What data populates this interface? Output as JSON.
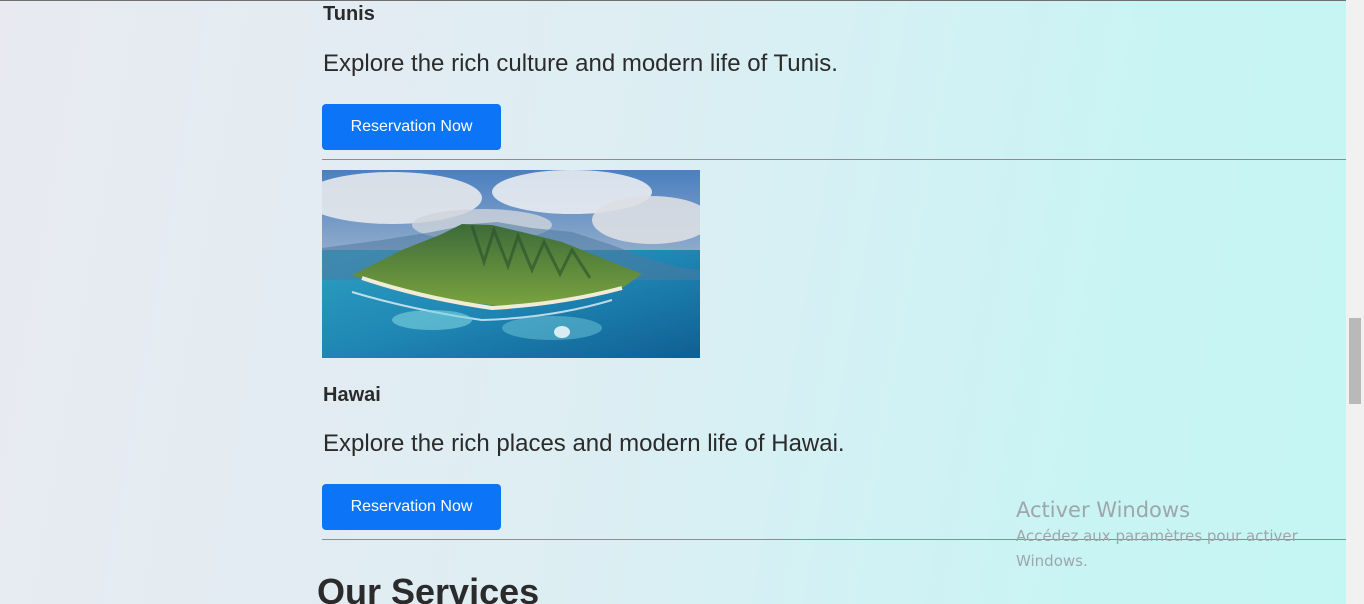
{
  "destinations": [
    {
      "title": "Tunis",
      "description": "Explore the rich culture and modern life of Tunis.",
      "button_label": "Reservation Now"
    },
    {
      "title": "Hawai",
      "description": "Explore the rich places and modern life of Hawai.",
      "button_label": "Reservation Now",
      "image": "island-aerial-photo"
    }
  ],
  "sections": {
    "services_title": "Our Services"
  },
  "watermark": {
    "title": "Activer Windows",
    "subtitle": "Accédez aux paramètres pour activer Windows."
  },
  "colors": {
    "button": "#0b74f7",
    "button_text": "#ffffff",
    "text": "#2b2b2b"
  }
}
